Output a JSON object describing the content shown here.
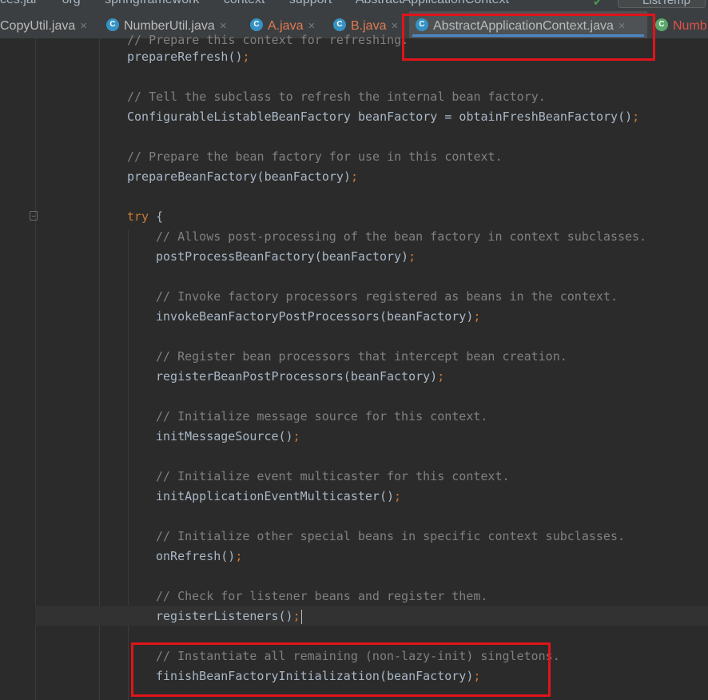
{
  "breadcrumb": {
    "items": [
      "ces.jar",
      "org",
      "springframework",
      "context",
      "support",
      "AbstractApplicationContext"
    ],
    "right_box": "ListTemp"
  },
  "tabs": [
    {
      "label": "CopyUtil.java",
      "has_icon": false,
      "active": false
    },
    {
      "label": "NumberUtil.java",
      "has_icon": true,
      "active": false
    },
    {
      "label": "A.java",
      "has_icon": true,
      "active": false
    },
    {
      "label": "B.java",
      "has_icon": true,
      "active": false
    },
    {
      "label": "AbstractApplicationContext.java",
      "has_icon": true,
      "active": true
    },
    {
      "label": "Numb",
      "has_icon": true,
      "active": false
    }
  ],
  "tab_icon_letter": "C",
  "close_glyph": "×",
  "code": {
    "line_0": "// Prepare this context for refreshing.",
    "line_1": "prepareRefresh",
    "line_3": "// Tell the subclass to refresh the internal bean factory.",
    "line_4a": "ConfigurableListableBeanFactory beanFactory = obtainFreshBeanFactory()",
    "line_6": "// Prepare the bean factory for use in this context.",
    "line_7": "prepareBeanFactory(beanFactory)",
    "line_9_kw": "try",
    "line_9_rest": " {",
    "line_10": "// Allows post-processing of the bean factory in context subclasses.",
    "line_11": "postProcessBeanFactory(beanFactory)",
    "line_13": "// Invoke factory processors registered as beans in the context.",
    "line_14": "invokeBeanFactoryPostProcessors(beanFactory)",
    "line_16": "// Register bean processors that intercept bean creation.",
    "line_17": "registerBeanPostProcessors(beanFactory)",
    "line_19": "// Initialize message source for this context.",
    "line_20": "initMessageSource()",
    "line_22": "// Initialize event multicaster for this context.",
    "line_23": "initApplicationEventMulticaster()",
    "line_25": "// Initialize other special beans in specific context subclasses.",
    "line_26": "onRefresh()",
    "line_28": "// Check for listener beans and register them.",
    "line_29": "registerListeners()",
    "line_31": "// Instantiate all remaining (non-lazy-init) singletons.",
    "line_32": "finishBeanFactoryInitialization(beanFactory)",
    "semicolon": ";",
    "parens": "()"
  },
  "colors": {
    "comment": "#808080",
    "keyword": "#cc7832",
    "text": "#a9b7c6",
    "annotation": "#e0141a",
    "active_tab_underline": "#4a88c7"
  }
}
